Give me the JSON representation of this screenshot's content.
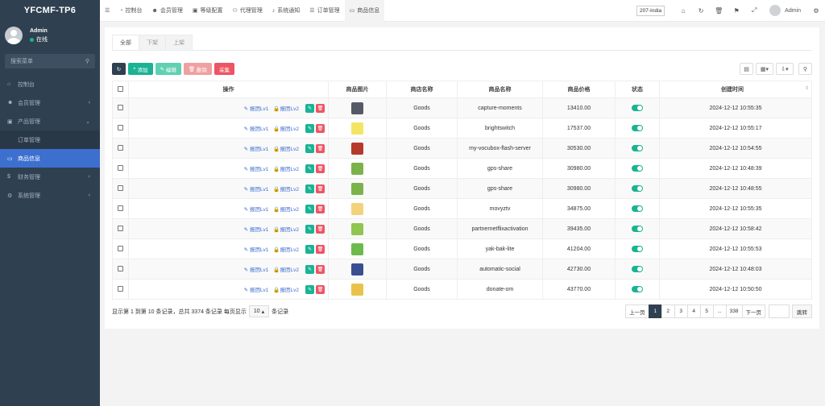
{
  "sidebar": {
    "brand": "YFCMF-TP6",
    "user": {
      "name": "Admin",
      "status": "在线"
    },
    "search_placeholder": "搜索菜单",
    "items": [
      {
        "label": "控制台",
        "icon": "dashboard-icon",
        "glyph": "⌂",
        "arrow": ""
      },
      {
        "label": "会员管理",
        "icon": "users-icon",
        "glyph": "☻",
        "arrow": "‹"
      },
      {
        "label": "产品管理",
        "icon": "box-icon",
        "glyph": "▣",
        "arrow": "⌄"
      },
      {
        "label": "订单管理",
        "icon": "",
        "glyph": "",
        "arrow": ""
      },
      {
        "label": "商品信息",
        "icon": "monitor-icon",
        "glyph": "▭",
        "arrow": ""
      },
      {
        "label": "财务管理",
        "icon": "dollar-icon",
        "glyph": "$",
        "arrow": "‹"
      },
      {
        "label": "系统管理",
        "icon": "gears-icon",
        "glyph": "⚙",
        "arrow": "‹"
      }
    ]
  },
  "topbar": {
    "tabs": [
      {
        "label": "控制台",
        "glyph": "◔"
      },
      {
        "label": "会员管理",
        "glyph": "☻"
      },
      {
        "label": "等级配置",
        "glyph": "▣"
      },
      {
        "label": "代理管理",
        "glyph": "⚇"
      },
      {
        "label": "系统通知",
        "glyph": "♪"
      },
      {
        "label": "订单管理",
        "glyph": "☰"
      },
      {
        "label": "商品信息",
        "glyph": "▭"
      }
    ],
    "region": "207-India",
    "admin": "Admin"
  },
  "filter_tabs": [
    "全部",
    "下架",
    "上架"
  ],
  "toolbar": {
    "add": "添加",
    "edit": "编辑",
    "delete": "删除",
    "collect": "采集"
  },
  "table": {
    "headers": [
      "操作",
      "商品图片",
      "商店名称",
      "商品名称",
      "商品价格",
      "状态",
      "创建时间"
    ],
    "op_link_1": "报团Lv1",
    "op_link_2": "报团Lv2",
    "rows": [
      {
        "shop": "Goods",
        "name": "capture-moments",
        "price": "13410.00",
        "status": true,
        "created": "2024-12-12 10:55:35",
        "img_color": "#555a66"
      },
      {
        "shop": "Goods",
        "name": "brightswitch",
        "price": "17537.00",
        "status": true,
        "created": "2024-12-12 10:55:17",
        "img_color": "#f4e463"
      },
      {
        "shop": "Goods",
        "name": "my-vocubox-flash-server",
        "price": "30530.00",
        "status": true,
        "created": "2024-12-12 10:54:55",
        "img_color": "#b53a2b"
      },
      {
        "shop": "Goods",
        "name": "gps-share",
        "price": "30980.00",
        "status": true,
        "created": "2024-12-12 10:48:39",
        "img_color": "#7bb34a"
      },
      {
        "shop": "Goods",
        "name": "gps-share",
        "price": "30980.00",
        "status": true,
        "created": "2024-12-12 10:48:55",
        "img_color": "#7bb34a"
      },
      {
        "shop": "Goods",
        "name": "movyztv",
        "price": "34875.00",
        "status": true,
        "created": "2024-12-12 10:55:35",
        "img_color": "#f2d27a"
      },
      {
        "shop": "Goods",
        "name": "partnernetflixactivation",
        "price": "39435.00",
        "status": true,
        "created": "2024-12-12 10:58:42",
        "img_color": "#8fc64f"
      },
      {
        "shop": "Goods",
        "name": "yak-bak-lite",
        "price": "41204.00",
        "status": true,
        "created": "2024-12-12 10:55:53",
        "img_color": "#6cba4c"
      },
      {
        "shop": "Goods",
        "name": "automatic-social",
        "price": "42730.00",
        "status": true,
        "created": "2024-12-12 10:48:03",
        "img_color": "#3a4f8f"
      },
      {
        "shop": "Goods",
        "name": "donate-om",
        "price": "43770.00",
        "status": true,
        "created": "2024-12-12 10:50:50",
        "img_color": "#e8c24a"
      }
    ]
  },
  "footer": {
    "info_prefix": "显示第 1 到第 10 条记录，总共 3374 条记录 每页显示",
    "page_size": "10",
    "info_suffix": "条记录",
    "prev": "上一页",
    "pages": [
      "1",
      "2",
      "3",
      "4",
      "5",
      "...",
      "338"
    ],
    "next": "下一页",
    "go": "跳转"
  }
}
